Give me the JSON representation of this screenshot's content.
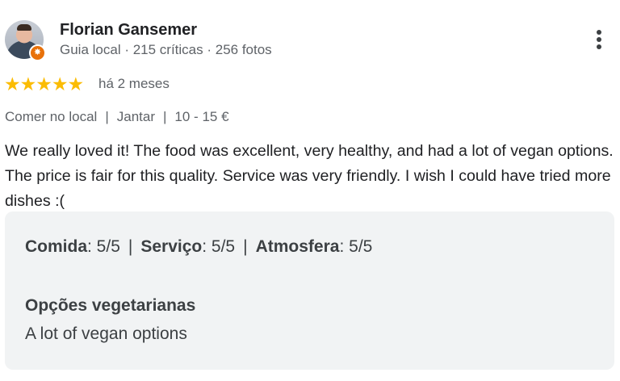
{
  "author": {
    "name": "Florian Gansemer",
    "meta": "Guia local · 215 críticas · 256 fotos",
    "badge_icon": "local-guide-star-icon",
    "badge_color": "#e8710a"
  },
  "more_menu": {
    "icon": "vertical-dots-icon"
  },
  "rating": {
    "stars_text": "★★★★★",
    "stars_value": 5,
    "stars_max": 5,
    "star_color": "#fbbc04",
    "date": "há 2 meses"
  },
  "tags": {
    "service": "Comer no local",
    "meal": "Jantar",
    "price": "10 - 15 €",
    "separator": "|"
  },
  "review_text": "We really loved it! The food was excellent, very healthy, and had a lot of vegan options. The price is fair for this quality. Service was very friendly. I wish I could have tried more dishes :(",
  "attributes": {
    "food_label": "Comida",
    "food_value": ": 5/5",
    "service_label": "Serviço",
    "service_value": ": 5/5",
    "atmosphere_label": "Atmosfera",
    "atmosphere_value": ": 5/5",
    "separator": "|",
    "vegetarian_heading": "Opções vegetarianas",
    "vegetarian_value": "A lot of vegan options"
  }
}
